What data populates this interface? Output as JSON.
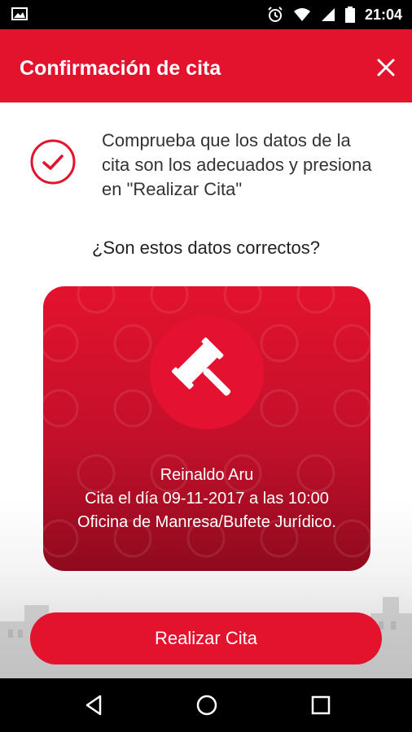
{
  "status_bar": {
    "time": "21:04",
    "icons": [
      "image-icon",
      "alarm-icon",
      "wifi-icon",
      "signal-icon",
      "battery-icon"
    ]
  },
  "app_bar": {
    "title": "Confirmación de cita",
    "close_icon": "close-icon"
  },
  "instruction": {
    "icon": "check-circle-icon",
    "text": "Comprueba que los datos de la cita son los adecuados y presiona en \"Realizar Cita\""
  },
  "question": "¿Son estos datos correctos?",
  "card": {
    "icon": "gavel-icon",
    "name": "Reinaldo Aru",
    "date_line": "Cita el día 09-11-2017 a las 10:00",
    "office_line": "Oficina de Manresa/Bufete Jurídico."
  },
  "primary_button": {
    "label": "Realizar Cita"
  },
  "nav_bar": {
    "icons": [
      "back-icon",
      "home-icon",
      "recents-icon"
    ]
  },
  "colors": {
    "accent": "#e3122d",
    "card_dark": "#8f0a1e",
    "text": "#333333"
  }
}
